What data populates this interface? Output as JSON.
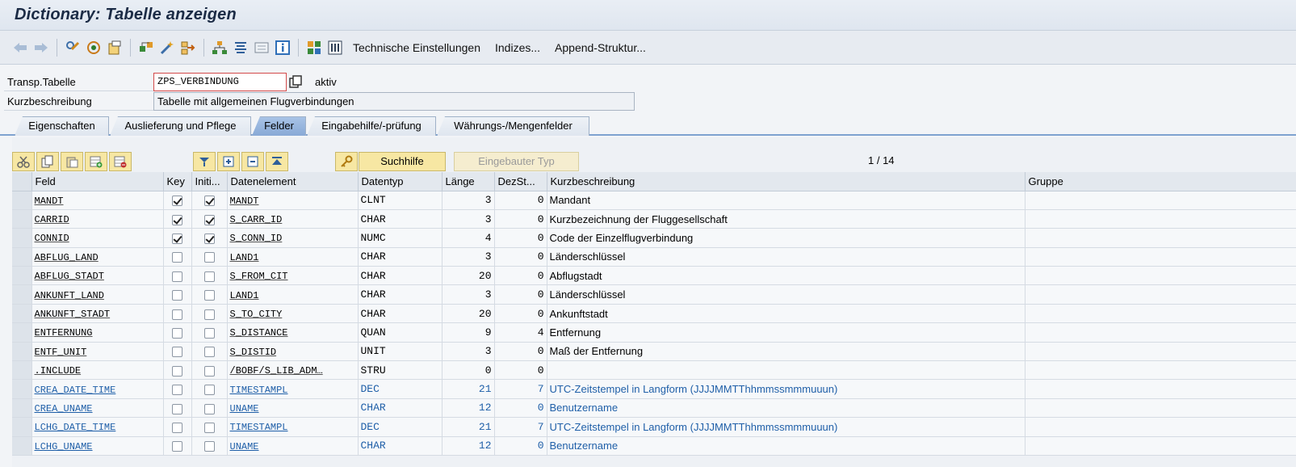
{
  "window": {
    "title": "Dictionary: Tabelle anzeigen"
  },
  "toolbar": {
    "icons": [
      "back-arrow-icon",
      "forward-arrow-icon",
      "other-object-icon",
      "display-change-icon",
      "activate-icon",
      "check-icon",
      "where-used-icon",
      "object-list-icon",
      "navigation-icon",
      "hierarchy-icon",
      "display-object-list-icon",
      "documentation-icon",
      "info-icon",
      "contents-icon",
      "entries-icon"
    ],
    "technical_settings": "Technische Einstellungen",
    "indexes": "Indizes...",
    "append_structure": "Append-Struktur..."
  },
  "header": {
    "table_label": "Transp.Tabelle",
    "table_value": "ZPS_VERBINDUNG",
    "status": "aktiv",
    "short_desc_label": "Kurzbeschreibung",
    "short_desc_value": "Tabelle mit allgemeinen Flugverbindungen"
  },
  "tabs": [
    {
      "label": "Eigenschaften"
    },
    {
      "label": "Auslieferung und Pflege"
    },
    {
      "label": "Felder",
      "active": true
    },
    {
      "label": "Eingabehilfe/-prüfung"
    },
    {
      "label": "Währungs-/Mengenfelder"
    }
  ],
  "grid_toolbar": {
    "search_help": "Suchhilfe",
    "builtin_type": "Eingebauter Typ",
    "pager": "1 / 14"
  },
  "columns": {
    "field": "Feld",
    "key": "Key",
    "initial": "Initi...",
    "data_element": "Datenelement",
    "data_type": "Datentyp",
    "length": "Länge",
    "decimals": "DezSt...",
    "short_desc": "Kurzbeschreibung",
    "group": "Gruppe"
  },
  "rows": [
    {
      "field": "MANDT",
      "key": true,
      "init": true,
      "elem": "MANDT",
      "type": "CLNT",
      "len": "3",
      "dec": "0",
      "desc": "Mandant"
    },
    {
      "field": "CARRID",
      "key": true,
      "init": true,
      "elem": "S_CARR_ID",
      "type": "CHAR",
      "len": "3",
      "dec": "0",
      "desc": "Kurzbezeichnung der Fluggesellschaft"
    },
    {
      "field": "CONNID",
      "key": true,
      "init": true,
      "elem": "S_CONN_ID",
      "type": "NUMC",
      "len": "4",
      "dec": "0",
      "desc": "Code der Einzelflugverbindung"
    },
    {
      "field": "ABFLUG_LAND",
      "key": false,
      "init": false,
      "elem": "LAND1",
      "type": "CHAR",
      "len": "3",
      "dec": "0",
      "desc": "Länderschlüssel"
    },
    {
      "field": "ABFLUG_STADT",
      "key": false,
      "init": false,
      "elem": "S_FROM_CIT",
      "type": "CHAR",
      "len": "20",
      "dec": "0",
      "desc": "Abflugstadt"
    },
    {
      "field": "ANKUNFT_LAND",
      "key": false,
      "init": false,
      "elem": "LAND1",
      "type": "CHAR",
      "len": "3",
      "dec": "0",
      "desc": "Länderschlüssel"
    },
    {
      "field": "ANKUNFT_STADT",
      "key": false,
      "init": false,
      "elem": "S_TO_CITY",
      "type": "CHAR",
      "len": "20",
      "dec": "0",
      "desc": "Ankunftstadt"
    },
    {
      "field": "ENTFERNUNG",
      "key": false,
      "init": false,
      "elem": "S_DISTANCE",
      "type": "QUAN",
      "len": "9",
      "dec": "4",
      "desc": "Entfernung"
    },
    {
      "field": "ENTF_UNIT",
      "key": false,
      "init": false,
      "elem": "S_DISTID",
      "type": "UNIT",
      "len": "3",
      "dec": "0",
      "desc": "Maß der Entfernung"
    },
    {
      "field": ".INCLUDE",
      "key": false,
      "init": false,
      "elem": "/BOBF/S_LIB_ADM…",
      "type": "STRU",
      "len": "0",
      "dec": "0",
      "desc": ""
    },
    {
      "field": "CREA_DATE_TIME",
      "key": false,
      "init": false,
      "elem": "TIMESTAMPL",
      "type": "DEC",
      "len": "21",
      "dec": "7",
      "desc": "UTC-Zeitstempel in Langform (JJJJMMTThhmmssmmmuuun)",
      "blue": true
    },
    {
      "field": "CREA_UNAME",
      "key": false,
      "init": false,
      "elem": "UNAME",
      "type": "CHAR",
      "len": "12",
      "dec": "0",
      "desc": "Benutzername",
      "blue": true
    },
    {
      "field": "LCHG_DATE_TIME",
      "key": false,
      "init": false,
      "elem": "TIMESTAMPL",
      "type": "DEC",
      "len": "21",
      "dec": "7",
      "desc": "UTC-Zeitstempel in Langform (JJJJMMTThhmmssmmmuuun)",
      "blue": true
    },
    {
      "field": "LCHG_UNAME",
      "key": false,
      "init": false,
      "elem": "UNAME",
      "type": "CHAR",
      "len": "12",
      "dec": "0",
      "desc": "Benutzername",
      "blue": true
    }
  ]
}
